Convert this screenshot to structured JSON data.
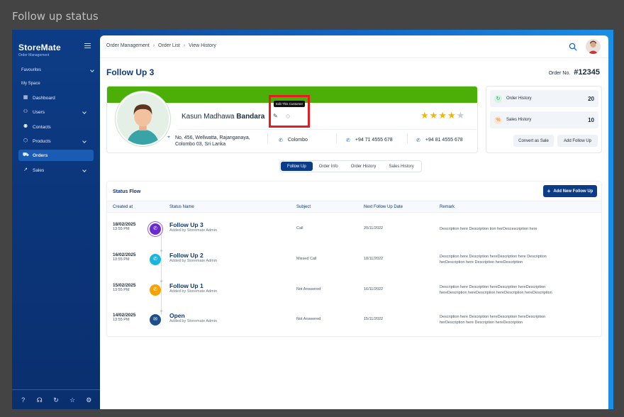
{
  "page_caption": "Follow up status",
  "sidebar": {
    "brand": "StoreMate",
    "brand_sub": "Order Management",
    "sections": {
      "favourites": "Favourites",
      "my_space": "My Space"
    },
    "items": [
      {
        "label": "Dashboard",
        "icon": "grid-icon"
      },
      {
        "label": "Users",
        "icon": "user-icon"
      },
      {
        "label": "Contacts",
        "icon": "contacts-icon"
      },
      {
        "label": "Products",
        "icon": "box-icon"
      },
      {
        "label": "Orders",
        "icon": "cart-icon"
      },
      {
        "label": "Sales",
        "icon": "trend-icon"
      }
    ],
    "footer_icons": [
      "help-icon",
      "headset-icon",
      "refresh-icon",
      "star-icon",
      "settings-icon"
    ]
  },
  "breadcrumb": [
    "Order Management",
    "Order List",
    "View History"
  ],
  "heading": "Follow Up 3",
  "order_label": "Order No.",
  "order_number": "#12345",
  "customer": {
    "first_name": "Kasun Madhawa",
    "last_name": "Bandara",
    "tooltip": "Edit This Customer",
    "rating": 4,
    "rating_max": 5,
    "address_line1": "No, 456, Wellwatta, Rajanganaya,",
    "address_line2": "Colombo 03, Sri Lanka",
    "city": "Colombo",
    "phone1": "+94 71 4555 678",
    "phone2": "+94 81 4555 678"
  },
  "history": {
    "order_history_label": "Order History",
    "order_history_count": "20",
    "sales_history_label": "Sales History",
    "sales_history_count": "10",
    "convert_btn": "Convert as Sale",
    "add_follow_btn": "Add Follow Up"
  },
  "tabs": [
    "Follow Up",
    "Order Info",
    "Order History",
    "Sales History"
  ],
  "status_flow": {
    "title": "Status Flow",
    "add_btn": "Add New Follow Up",
    "columns": [
      "Created at",
      "Status Name",
      "Subject",
      "Next Follow Up Date",
      "Remark"
    ],
    "rows": [
      {
        "date": "18/02/2025",
        "time": "13:55 PM",
        "status": "Follow Up 3",
        "added_by": "Added by Storemate Admin",
        "subject": "Call",
        "next_date": "20/11/2022",
        "remark1": "Description here Description tion herDescescription here",
        "remark2": "",
        "node_color": "#6a2bd0",
        "node_icon": "phone-icon"
      },
      {
        "date": "16/02/2025",
        "time": "13:55 PM",
        "status": "Follow Up 2",
        "added_by": "Added by Storemate Admin",
        "subject": "Missed Call",
        "next_date": "18/11/2022",
        "remark1": "Description here Description hereDescription here Description",
        "remark2": "herDescription here Description hereDescription",
        "node_color": "#19b7e0",
        "node_icon": "phone-icon"
      },
      {
        "date": "15/02/2025",
        "time": "13:55 PM",
        "status": "Follow Up 1",
        "added_by": "Added by Storemate Admin",
        "subject": "Not Answered",
        "next_date": "16/11/2022",
        "remark1": "Description here Description hereDescription hereDescription",
        "remark2": "hereDescription hereDescription hereDescription hereDescription",
        "node_color": "#f5a300",
        "node_icon": "phone-icon"
      },
      {
        "date": "14/02/2025",
        "time": "13:55 PM",
        "status": "Open",
        "added_by": "Added by Storemate Admin",
        "subject": "Not Answered",
        "next_date": "15/11/2022",
        "remark1": "Description here Description hereDescription hereDescription",
        "remark2": "herDescription here Description hereDescription",
        "node_color": "#1c4f8c",
        "node_icon": "mail-icon"
      }
    ]
  }
}
